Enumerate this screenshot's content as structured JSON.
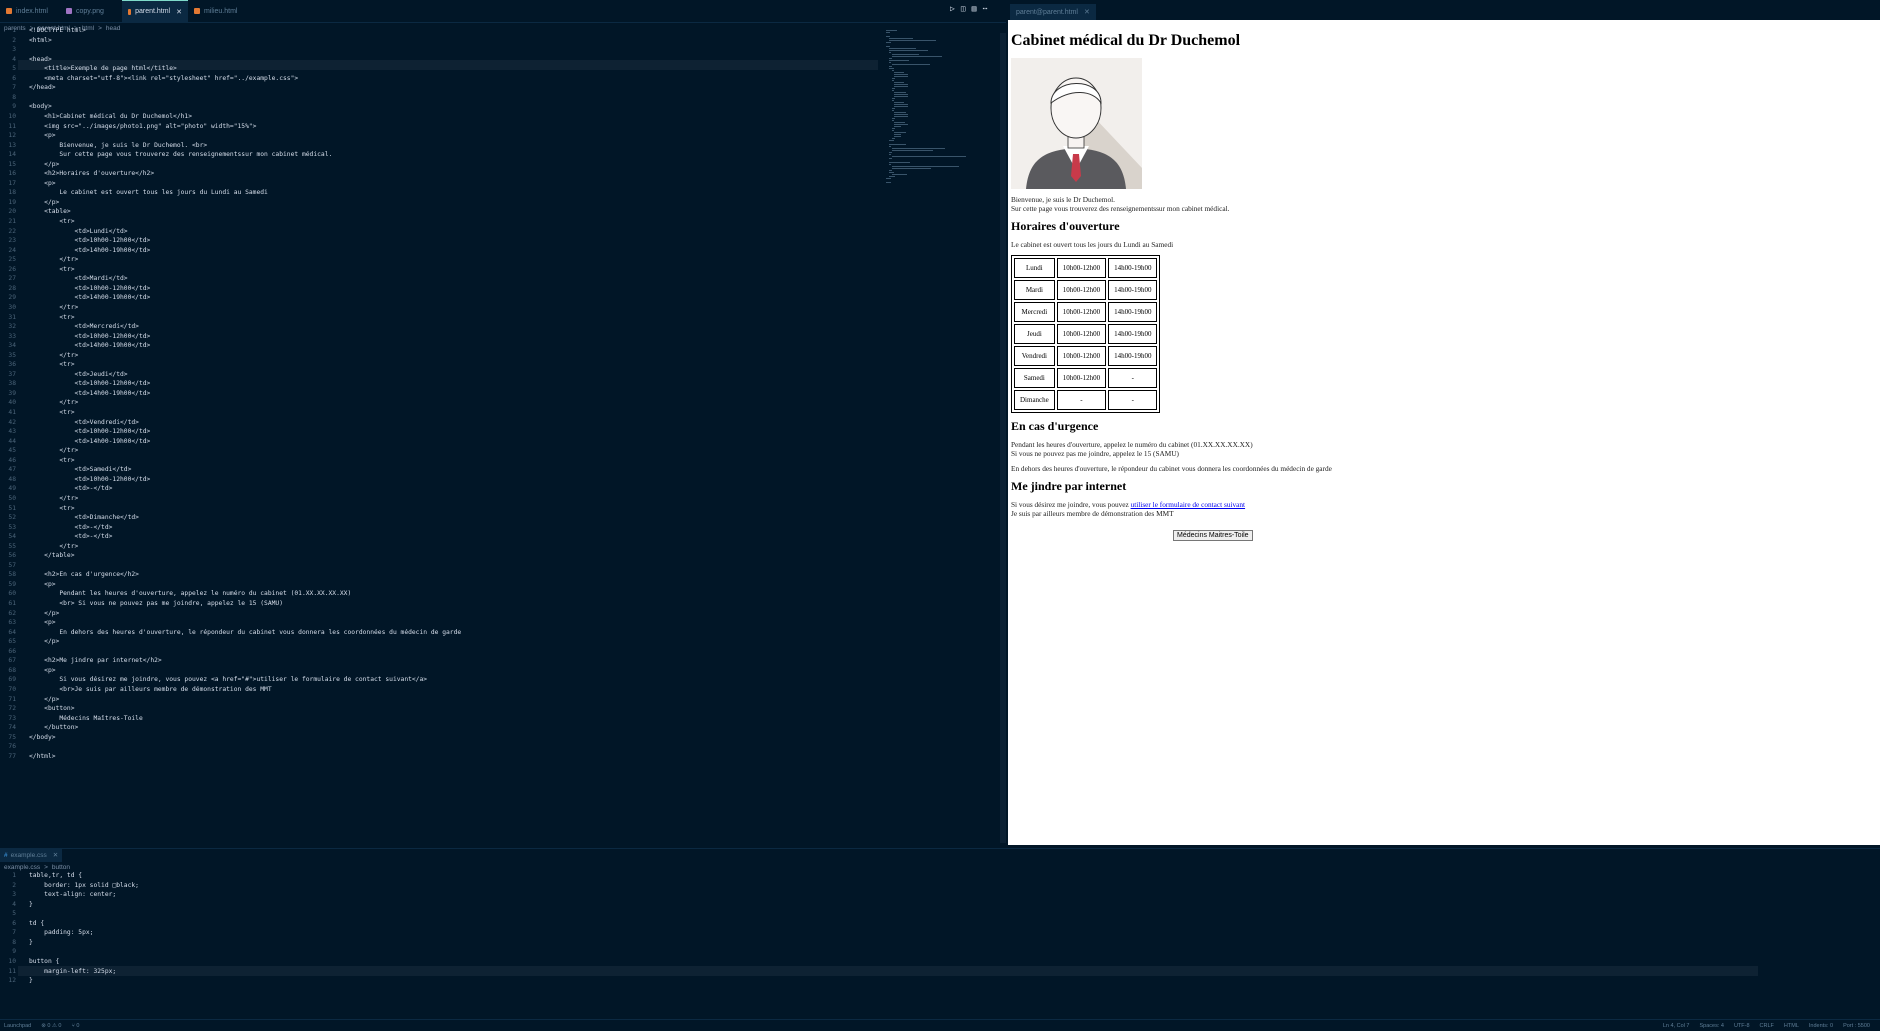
{
  "tabs": [
    {
      "label": "index.html",
      "color": "#e37933"
    },
    {
      "label": "copy.png",
      "color": "#a074c4"
    },
    {
      "label": "parent.html",
      "color": "#e37933"
    },
    {
      "label": "milieu.html",
      "color": "#e37933"
    }
  ],
  "breadcrumb": [
    "parents",
    ">",
    "parent.html",
    ">",
    "html",
    ">",
    "head"
  ],
  "preview_tab": "parent@parent.html",
  "html_code": [
    "<!DOCTYPE html>",
    "<html>",
    "",
    "<head>",
    "    <title>Exemple de page html</title>",
    "    <meta charset=\"utf-8\"><link rel=\"stylesheet\" href=\"../example.css\">",
    "</head>",
    "",
    "<body>",
    "    <h1>Cabinet médical du Dr Duchemol</h1>",
    "    <img src=\"../images/photo1.png\" alt=\"photo\" width=\"15%\">",
    "    <p>",
    "        Bienvenue, je suis le Dr Duchemol. <br>",
    "        Sur cette page vous trouverez des renseignementssur mon cabinet médical.",
    "    </p>",
    "    <h2>Horaires d'ouverture</h2>",
    "    <p>",
    "        Le cabinet est ouvert tous les jours du Lundi au Samedi",
    "    </p>",
    "    <table>",
    "        <tr>",
    "            <td>Lundi</td>",
    "            <td>10h00-12h00</td>",
    "            <td>14h00-19h00</td>",
    "        </tr>",
    "        <tr>",
    "            <td>Mardi</td>",
    "            <td>10h00-12h00</td>",
    "            <td>14h00-19h00</td>",
    "        </tr>",
    "        <tr>",
    "            <td>Mercredi</td>",
    "            <td>10h00-12h00</td>",
    "            <td>14h00-19h00</td>",
    "        </tr>",
    "        <tr>",
    "            <td>Jeudi</td>",
    "            <td>10h00-12h00</td>",
    "            <td>14h00-19h00</td>",
    "        </tr>",
    "        <tr>",
    "            <td>Vendredi</td>",
    "            <td>10h00-12h00</td>",
    "            <td>14h00-19h00</td>",
    "        </tr>",
    "        <tr>",
    "            <td>Samedi</td>",
    "            <td>10h00-12h00</td>",
    "            <td>-</td>",
    "        </tr>",
    "        <tr>",
    "            <td>Dimanche</td>",
    "            <td>-</td>",
    "            <td>-</td>",
    "        </tr>",
    "    </table>",
    "",
    "    <h2>En cas d'urgence</h2>",
    "    <p>",
    "        Pendant les heures d'ouverture, appelez le numéro du cabinet (01.XX.XX.XX.XX)",
    "        <br> Si vous ne pouvez pas me joindre, appelez le 15 (SAMU)",
    "    </p>",
    "    <p>",
    "        En dehors des heures d'ouverture, le répondeur du cabinet vous donnera les coordonnées du médecin de garde",
    "    </p>",
    "",
    "    <h2>Me jindre par internet</h2>",
    "    <p>",
    "        Si vous désirez me joindre, vous pouvez <a href=\"#\">utiliser le formulaire de contact suivant</a>",
    "        <br>Je suis par ailleurs membre de démonstration des MMT",
    "    </p>",
    "    <button>",
    "        Médecins Maîtres-Toile",
    "    </button>",
    "</body>",
    "",
    "</html>"
  ],
  "preview": {
    "h1": "Cabinet médical du Dr Duchemol",
    "intro_1": "Bienvenue, je suis le Dr Duchemol.",
    "intro_2": "Sur cette page vous trouverez des renseignementssur mon cabinet médical.",
    "h2_hours": "Horaires d'ouverture",
    "hours_text": "Le cabinet est ouvert tous les jours du Lundi au Samedi",
    "table": [
      [
        "Lundi",
        "10h00-12h00",
        "14h00-19h00"
      ],
      [
        "Mardi",
        "10h00-12h00",
        "14h00-19h00"
      ],
      [
        "Mercredi",
        "10h00-12h00",
        "14h00-19h00"
      ],
      [
        "Jeudi",
        "10h00-12h00",
        "14h00-19h00"
      ],
      [
        "Vendredi",
        "10h00-12h00",
        "14h00-19h00"
      ],
      [
        "Samedi",
        "10h00-12h00",
        "-"
      ],
      [
        "Dimanche",
        "-",
        "-"
      ]
    ],
    "h2_urgence": "En cas d'urgence",
    "urg_1": "Pendant les heures d'ouverture, appelez le numéro du cabinet (01.XX.XX.XX.XX)",
    "urg_2": "Si vous ne pouvez pas me joindre, appelez le 15 (SAMU)",
    "urg_3": "En dehors des heures d'ouverture, le répondeur du cabinet vous donnera les coordonnées du médecin de garde",
    "h2_internet": "Me jindre par internet",
    "net_1": "Si vous désirez me joindre, vous pouvez ",
    "net_link": "utiliser le formulaire de contact suivant",
    "net_2": "Je suis par ailleurs membre de démonstration des MMT",
    "button": "Médecins Maitres-Toile"
  },
  "bottom_tab": "example.css",
  "bottom_breadcrumb": [
    "example.css",
    ">",
    "button"
  ],
  "css_code": [
    "table,tr, td {",
    "    border: 1px solid □black;",
    "    text-align: center;",
    "}",
    "",
    "td {",
    "    padding: 5px;",
    "}",
    "",
    "button {",
    "    margin-left: 325px;",
    "}"
  ],
  "status": {
    "left": [
      "Launchpad",
      "⊗ 0 ⚠ 0",
      "⑂ 0"
    ],
    "right": [
      "Ln 4, Col 7",
      "Spaces: 4",
      "UTF-8",
      "CRLF",
      "HTML",
      "Indents: 0",
      "Port : 5500"
    ]
  }
}
